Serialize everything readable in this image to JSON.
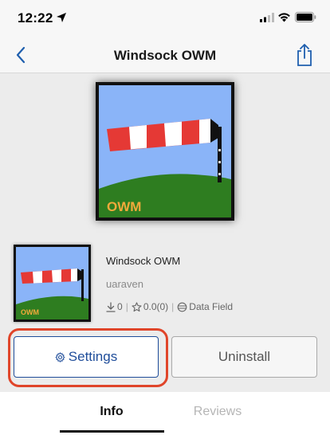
{
  "status_bar": {
    "time": "12:22"
  },
  "nav": {
    "title": "Windsock OWM"
  },
  "hero": {
    "badge": "OWM"
  },
  "app": {
    "name": "Windsock OWM",
    "author": "uaraven",
    "downloads": "0",
    "rating": "0.0(0)",
    "type": "Data Field"
  },
  "actions": {
    "settings_label": "Settings",
    "uninstall_label": "Uninstall"
  },
  "tabs": [
    {
      "label": "Info",
      "active": true
    },
    {
      "label": "Reviews",
      "active": false
    }
  ],
  "colors": {
    "accent": "#1f4d9a",
    "highlight": "#e0452a",
    "sky": "#8ab4f8",
    "grass": "#2e7d20",
    "sock_red": "#e53935",
    "badge_text": "#f2a93b"
  },
  "icons": {
    "location": "location-arrow-icon",
    "signal": "cellular-signal-icon",
    "wifi": "wifi-icon",
    "battery": "battery-icon",
    "back": "chevron-left-icon",
    "share": "share-icon",
    "gear": "gear-icon",
    "download": "download-icon",
    "star": "star-icon",
    "datafield": "data-field-icon"
  }
}
